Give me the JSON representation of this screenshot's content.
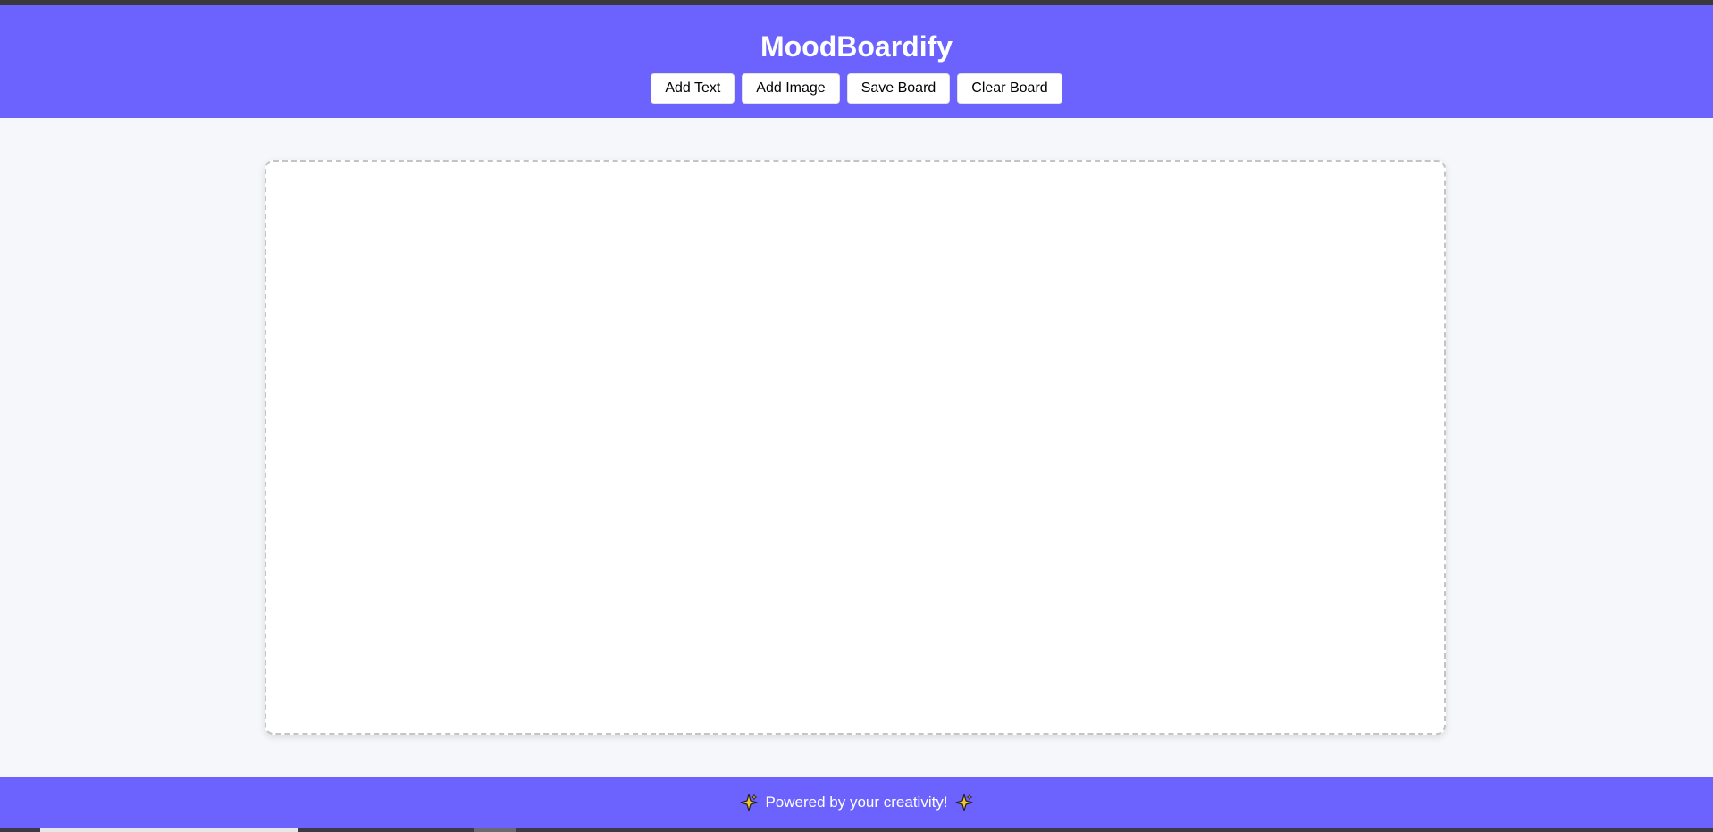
{
  "app": {
    "title": "MoodBoardify"
  },
  "toolbar": {
    "buttons": [
      {
        "label": "Add Text"
      },
      {
        "label": "Add Image"
      },
      {
        "label": "Save Board"
      },
      {
        "label": "Clear Board"
      }
    ]
  },
  "footer": {
    "text": "Powered by your creativity!",
    "icon": "sparkle-icon"
  },
  "colors": {
    "accent": "#6c63ff",
    "background": "#f6f7fa",
    "board": "#ffffff"
  }
}
